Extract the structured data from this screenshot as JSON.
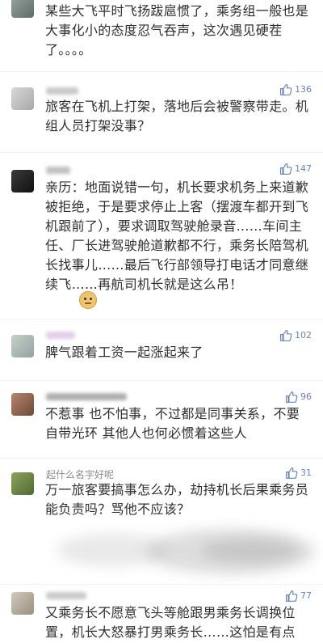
{
  "comments": [
    {
      "username": "",
      "text": "某些大飞平时飞扬跋扈惯了，乘务组一般也是大事化小的态度忍气吞声，这次遇见硬茬了。。。。",
      "likes": ""
    },
    {
      "username": "",
      "text": "旅客在飞机上打架，落地后会被警察带走。机组人员打架没事？",
      "likes": "136"
    },
    {
      "username": "",
      "text": "亲历：地面说错一句，机长要求机务上来道歉被拒绝，于是要求停止上客（摆渡车都开到飞机跟前了），要求调取驾驶舱录音……车间主任、厂长进驾驶舱道歉都不行，乘务长陪驾机长找事儿……最后飞行部领导打电话才同意继续飞……再航司机长就是这么吊！",
      "likes": "147"
    },
    {
      "username": "",
      "text": "脾气跟着工资一起涨起来了",
      "likes": "102"
    },
    {
      "username": "",
      "text": "不惹事 也不怕事，不过都是同事关系，不要自带光环 其他人也何必惯着这些人",
      "likes": "96"
    },
    {
      "username": "起什么名字好呢",
      "text": "万一旅客要搞事怎么办，劫持机长后果乘务员能负责吗？骂他不应该？",
      "likes": "31"
    },
    {
      "username": "",
      "text": "",
      "likes": ""
    },
    {
      "username": "",
      "text": "又乘务长不愿意飞头等舱跟男乘务长调换位置，机长大怒暴打男乘务长……这怕是有点",
      "likes": "77"
    }
  ],
  "emoji": "doge-emoji",
  "colors": {
    "accent": "#6a85b4",
    "text": "#2f2f2f",
    "muted": "#8a8a8a"
  }
}
